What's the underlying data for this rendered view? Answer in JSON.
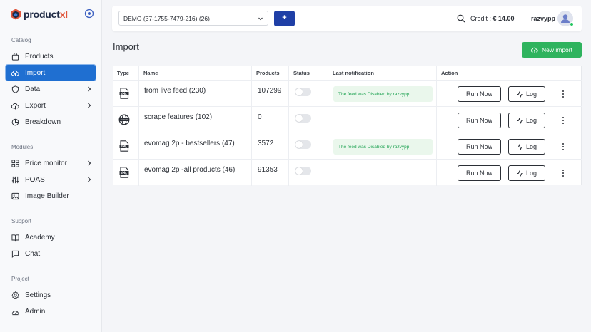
{
  "brand": {
    "name_main": "product",
    "name_accent": "xl",
    "accent_color": "#e0553b",
    "primary_color": "#1f6fd1"
  },
  "sidebar": {
    "sections": {
      "catalog": "Catalog",
      "modules": "Modules",
      "support": "Support",
      "project": "Project"
    },
    "items": [
      {
        "label": "Products",
        "icon": "bag-icon"
      },
      {
        "label": "Import",
        "icon": "cloud-upload-icon",
        "active": true
      },
      {
        "label": "Data",
        "icon": "shield-icon"
      },
      {
        "label": "Export",
        "icon": "cloud-download-icon"
      },
      {
        "label": "Breakdown",
        "icon": "pie-chart-icon"
      },
      {
        "label": "Price monitor",
        "icon": "grid-icon"
      },
      {
        "label": "POAS",
        "icon": "sliders-icon"
      },
      {
        "label": "Image Builder",
        "icon": "image-icon"
      },
      {
        "label": "Academy",
        "icon": "book-icon"
      },
      {
        "label": "Chat",
        "icon": "chat-icon"
      },
      {
        "label": "Settings",
        "icon": "gear-icon"
      },
      {
        "label": "Admin",
        "icon": "admin-icon"
      }
    ]
  },
  "topbar": {
    "feed_selected": "DEMO (37-1755-7479-216) (26)",
    "add_label": "+",
    "credit_label": "Credit :",
    "credit_value": "€ 14.00",
    "username": "razvypp"
  },
  "page": {
    "title": "Import",
    "new_import_label": "New import"
  },
  "table": {
    "headers": {
      "type": "Type",
      "name": "Name",
      "products": "Products",
      "status": "Status",
      "notification": "Last notification",
      "action": "Action"
    },
    "run_label": "Run Now",
    "log_label": "Log",
    "rows": [
      {
        "type": "xml-file-icon",
        "name": "from live feed (230)",
        "products": "107299",
        "enabled": false,
        "notification": "The feed was Disabled by razvypp"
      },
      {
        "type": "globe-icon",
        "name": "scrape features (102)",
        "products": "0",
        "enabled": false,
        "notification": ""
      },
      {
        "type": "xml-file-icon",
        "name": "evomag 2p - bestsellers (47)",
        "products": "3572",
        "enabled": false,
        "notification": "The feed was Disabled by razvypp"
      },
      {
        "type": "xml-file-icon",
        "name": "evomag 2p -all products (46)",
        "products": "91353",
        "enabled": false,
        "notification": ""
      }
    ]
  }
}
